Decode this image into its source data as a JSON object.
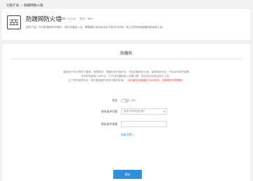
{
  "breadcrumb": {
    "parent": "功能扩展",
    "separator": ">",
    "current": "防蹭网防火墙"
  },
  "app": {
    "icon": "firewall-wall-icon",
    "title": "防蹭网防火墙",
    "version_label": "版本：",
    "version": "1.0.12",
    "size_label": "大小：",
    "size": "36G",
    "description": "插件介绍：开启防蹭网防护模式，现在设备接入后，需要通过身份验证后才能访问外网，防止您的网络被蹭网使用者占用。"
  },
  "main": {
    "section_title": "防蹭网",
    "paragraphs": [
      "蹭网用户仅仅等同于蹭网，而是更多，需要检查内网安全。开启防蹭网防火墙，保障网络安全。开启后所有终端需",
      "手机和电脑接入WiFi后，打开浏览器即输入设置问题，然后验证答案后即可上网。",
      "为了您的网络安全，请妥善保管好密码问题和答案！"
    ],
    "warning": "（该功能仅对普通主SSID有效，访客网络不受限制）",
    "status": {
      "label": "状态",
      "value": "OFF"
    },
    "question": {
      "label": "密码保护问题",
      "placeholder": "我多长时间回归来？"
    },
    "answer": {
      "label": "密码保护答案",
      "value": ""
    },
    "advanced_link": "高级设置>>",
    "save_label": "保存"
  },
  "colors": {
    "accent": "#2e8fe0",
    "link": "#3a8ee6",
    "warning": "#e8402f",
    "page_bg": "#f2f2f2"
  }
}
